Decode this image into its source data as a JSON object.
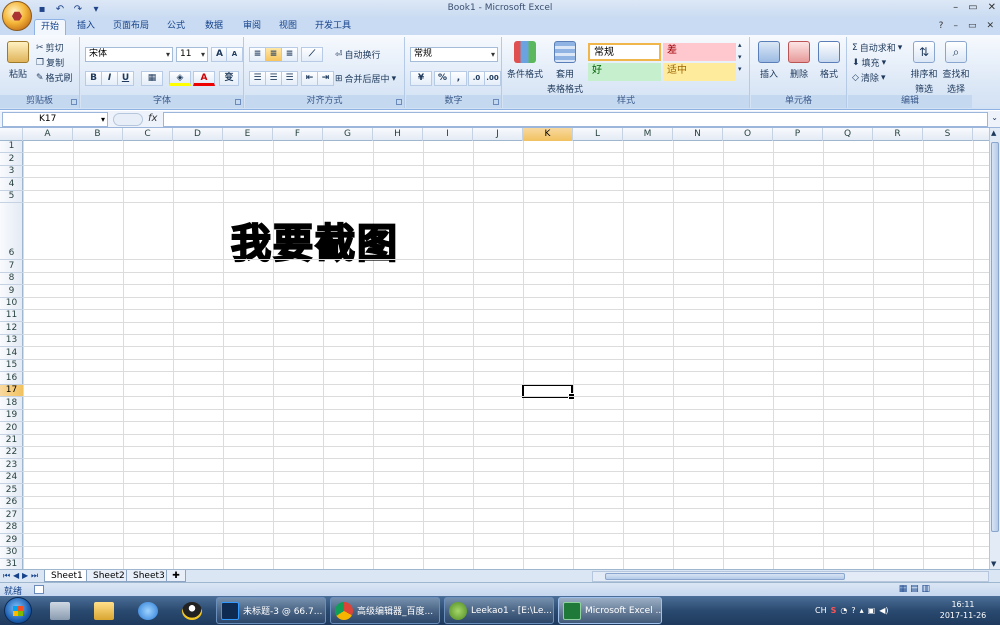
{
  "window": {
    "title": "Book1 - Microsoft Excel"
  },
  "tabs": [
    {
      "label": "开始",
      "active": true
    },
    {
      "label": "插入"
    },
    {
      "label": "页面布局"
    },
    {
      "label": "公式"
    },
    {
      "label": "数据"
    },
    {
      "label": "审阅"
    },
    {
      "label": "视图"
    },
    {
      "label": "开发工具"
    }
  ],
  "ribbon": {
    "clipboard": {
      "label": "剪贴板",
      "paste": "粘贴",
      "cut": "剪切",
      "copy": "复制",
      "format_painter": "格式刷"
    },
    "font": {
      "label": "字体",
      "name": "宋体",
      "size": "11",
      "bold": "B",
      "italic": "I",
      "underline": "U",
      "grow": "A",
      "shrink": "A",
      "color_letter": "A",
      "phonetic": "变"
    },
    "alignment": {
      "label": "对齐方式",
      "wrap": "自动换行",
      "merge": "合并后居中"
    },
    "number": {
      "label": "数字",
      "format": "常规",
      "percent": "%",
      "comma": ","
    },
    "styles": {
      "label": "样式",
      "conditional": "条件格式",
      "table_1": "套用",
      "table_2": "表格格式",
      "cells": [
        {
          "text": "常规",
          "bg": "#ffffff",
          "fg": "#000000"
        },
        {
          "text": "差",
          "bg": "#ffc7ce",
          "fg": "#9c0006"
        },
        {
          "text": "好",
          "bg": "#c6efce",
          "fg": "#006100"
        },
        {
          "text": "适中",
          "bg": "#ffeb9c",
          "fg": "#9c6500"
        }
      ]
    },
    "cells": {
      "label": "单元格",
      "insert": "插入",
      "delete": "删除",
      "format": "格式"
    },
    "editing": {
      "label": "编辑",
      "autosum": "自动求和",
      "fill": "填充",
      "clear": "清除",
      "sort_1": "排序和",
      "sort_2": "筛选",
      "find_1": "查找和",
      "find_2": "选择"
    }
  },
  "formula_bar": {
    "name_box": "K17",
    "fx": "fx",
    "value": ""
  },
  "sheet": {
    "columns": [
      "A",
      "B",
      "C",
      "D",
      "E",
      "F",
      "G",
      "H",
      "I",
      "J",
      "K",
      "L",
      "M",
      "N",
      "O",
      "P",
      "Q",
      "R",
      "S"
    ],
    "rows": [
      "1",
      "2",
      "3",
      "4",
      "5",
      "6",
      "7",
      "8",
      "9",
      "10",
      "11",
      "12",
      "13",
      "14",
      "15",
      "16",
      "17",
      "18",
      "19",
      "20",
      "21",
      "22",
      "23",
      "24",
      "25",
      "26",
      "27",
      "28",
      "29",
      "30",
      "31"
    ],
    "selected_col": "K",
    "selected_row": "17",
    "cell_text": "我要截图"
  },
  "sheet_tabs": [
    "Sheet1",
    "Sheet2",
    "Sheet3"
  ],
  "status": {
    "text": "就绪"
  },
  "taskbar": {
    "tasks": [
      {
        "label": "未标题-3 @ 66.7...",
        "icon": "photoshop-icon",
        "color": "#0f2b52"
      },
      {
        "label": "高级编辑器_百度...",
        "icon": "chrome-icon",
        "color": "#e8b32a"
      },
      {
        "label": "Leekao1 - [E:\\Le...",
        "icon": "android-studio-icon",
        "color": "#7cb342"
      },
      {
        "label": "Microsoft Excel ...",
        "icon": "excel-icon",
        "color": "#1f7a3a",
        "active": true
      }
    ],
    "tray_lang": "CH",
    "time": "16:11",
    "date": "2017-11-26"
  }
}
